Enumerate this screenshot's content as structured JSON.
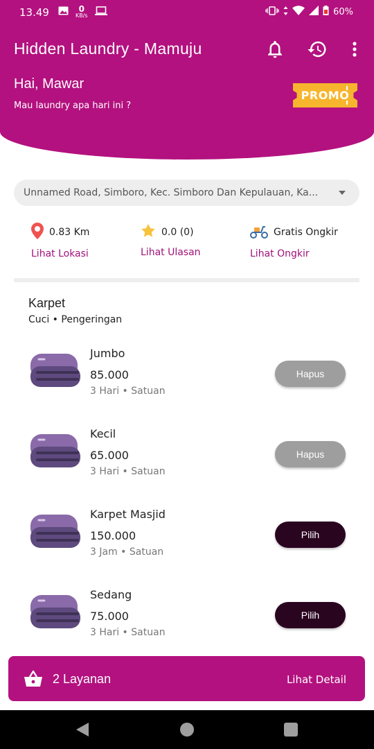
{
  "status_bar": {
    "time": "13.49",
    "kb_value": "0",
    "kb_unit": "KB/s",
    "battery": "60%"
  },
  "header": {
    "title": "Hidden Laundry - Mamuju",
    "greeting": "Hai, Mawar",
    "subtitle": "Mau laundry apa hari ini ?",
    "promo_label": "PROMO"
  },
  "address": {
    "value": "Unnamed Road, Simboro, Kec. Simboro Dan Kepulauan, Ka..."
  },
  "info": {
    "distance": {
      "value": "0.83 Km",
      "link": "Lihat Lokasi",
      "icon": "location-pin-icon"
    },
    "rating": {
      "value": "0.0 (0)",
      "link": "Lihat Ulasan",
      "icon": "star-icon"
    },
    "shipping": {
      "value": "Gratis Ongkir",
      "link": "Lihat Ongkir",
      "icon": "scooter-icon"
    }
  },
  "category": {
    "title": "Karpet",
    "subtitle": "Cuci • Pengeringan"
  },
  "items": [
    {
      "name": "Jumbo",
      "price": "85.000",
      "duration": "3 Hari",
      "unit": "Satuan",
      "button": "Hapus",
      "state": "selected"
    },
    {
      "name": "Kecil",
      "price": "65.000",
      "duration": "3 Hari",
      "unit": "Satuan",
      "button": "Hapus",
      "state": "selected"
    },
    {
      "name": "Karpet Masjid",
      "price": "150.000",
      "duration": "3 Jam",
      "unit": "Satuan",
      "button": "Pilih",
      "state": "unselected"
    },
    {
      "name": "Sedang",
      "price": "75.000",
      "duration": "3 Hari",
      "unit": "Satuan",
      "button": "Pilih",
      "state": "unselected"
    }
  ],
  "cart": {
    "count_label": "2 Layanan",
    "detail_label": "Lihat Detail"
  },
  "colors": {
    "primary": "#b3117f",
    "promo": "#f7b52e",
    "button_dark": "#2a0520",
    "button_grey": "#9e9e9e",
    "link": "#a0127a"
  }
}
